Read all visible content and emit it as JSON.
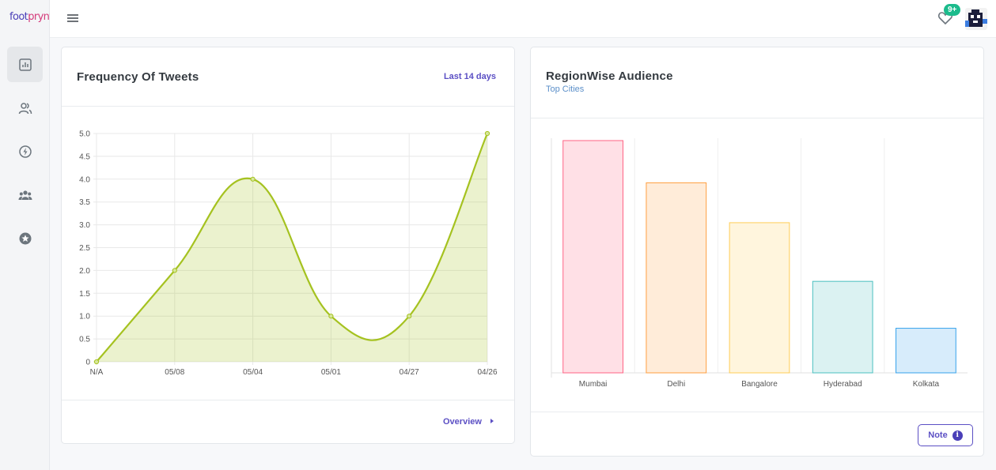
{
  "app": {
    "logo_part1": "foot",
    "logo_part2": "prynt"
  },
  "sidebar": {
    "items": [
      {
        "name": "analytics",
        "icon": "bar-chart-icon",
        "active": true
      },
      {
        "name": "users",
        "icon": "users-icon"
      },
      {
        "name": "activity",
        "icon": "lightning-icon"
      },
      {
        "name": "groups",
        "icon": "group-icon"
      },
      {
        "name": "favorites",
        "icon": "star-icon"
      }
    ]
  },
  "topbar": {
    "notification_count": "9+"
  },
  "tweets_card": {
    "title": "Frequency Of Tweets",
    "range_link": "Last 14 days",
    "footer_link": "Overview"
  },
  "audience_card": {
    "title": "RegionWise Audience",
    "subtitle": "Top Cities",
    "note_button": "Note"
  },
  "colors": {
    "accent": "#5b4fc4",
    "badge": "#1cbb8c",
    "line": "#a5c220"
  },
  "chart_data": [
    {
      "type": "area",
      "title": "",
      "categories": [
        "N/A",
        "05/08",
        "05/04",
        "05/01",
        "04/27",
        "04/26"
      ],
      "values": [
        0,
        2,
        4,
        1,
        1,
        5
      ],
      "ylim": [
        0,
        5
      ],
      "yticks": [
        "0",
        "0.5",
        "1.0",
        "1.5",
        "2.0",
        "2.5",
        "3.0",
        "3.5",
        "4.0",
        "4.5",
        "5.0"
      ],
      "grid": true,
      "color": "#a5c220"
    },
    {
      "type": "bar",
      "title": "",
      "categories": [
        "Mumbai",
        "Delhi",
        "Bangalore",
        "Hyderabad",
        "Kolkata"
      ],
      "values": [
        99,
        81,
        64,
        39,
        19
      ],
      "ylim": [
        0,
        100
      ],
      "grid": true,
      "fills": [
        "#ffe0e6",
        "#ffecd9",
        "#fff5dd",
        "#dbf2f2",
        "#d7ecfb"
      ],
      "strokes": [
        "#ff6384",
        "#ff9f40",
        "#ffcd56",
        "#4bc0c0",
        "#36a2eb"
      ]
    }
  ]
}
